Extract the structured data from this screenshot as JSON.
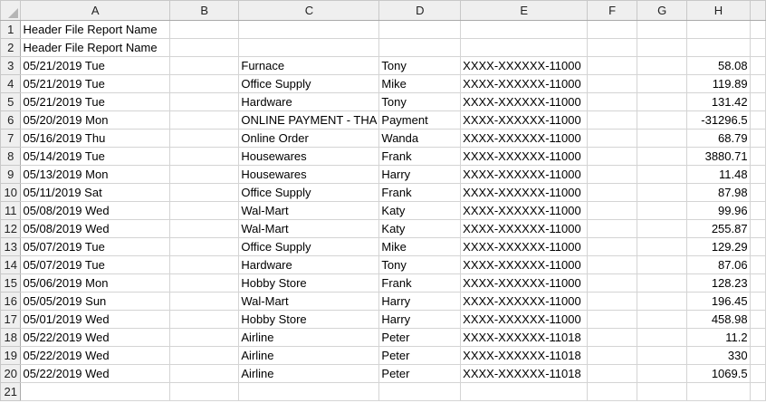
{
  "columns": [
    "A",
    "B",
    "C",
    "D",
    "E",
    "F",
    "G",
    "H",
    ""
  ],
  "header_rows": [
    {
      "num": "1",
      "text": "Header File Report Name"
    },
    {
      "num": "2",
      "text": "Header File Report Name"
    }
  ],
  "rows": [
    {
      "num": "3",
      "a": "05/21/2019  Tue",
      "c": "Furnace",
      "d": "Tony",
      "e": "XXXX-XXXXXX-11000",
      "h": "58.08"
    },
    {
      "num": "4",
      "a": "05/21/2019  Tue",
      "c": "Office Supply",
      "d": "Mike",
      "e": "XXXX-XXXXXX-11000",
      "h": "119.89"
    },
    {
      "num": "5",
      "a": "05/21/2019  Tue",
      "c": "Hardware",
      "d": "Tony",
      "e": "XXXX-XXXXXX-11000",
      "h": "131.42"
    },
    {
      "num": "6",
      "a": "05/20/2019  Mon",
      "c": "ONLINE PAYMENT - THA",
      "d": "Payment",
      "e": "XXXX-XXXXXX-11000",
      "h": "-31296.5"
    },
    {
      "num": "7",
      "a": "05/16/2019  Thu",
      "c": "Online Order",
      "d": "Wanda",
      "e": "XXXX-XXXXXX-11000",
      "h": "68.79"
    },
    {
      "num": "8",
      "a": "05/14/2019  Tue",
      "c": "Housewares",
      "d": "Frank",
      "e": "XXXX-XXXXXX-11000",
      "h": "3880.71"
    },
    {
      "num": "9",
      "a": "05/13/2019  Mon",
      "c": "Housewares",
      "d": "Harry",
      "e": "XXXX-XXXXXX-11000",
      "h": "11.48"
    },
    {
      "num": "10",
      "a": "05/11/2019  Sat",
      "c": "Office Supply",
      "d": "Frank",
      "e": "XXXX-XXXXXX-11000",
      "h": "87.98"
    },
    {
      "num": "11",
      "a": "05/08/2019  Wed",
      "c": "Wal-Mart",
      "d": "Katy",
      "e": "XXXX-XXXXXX-11000",
      "h": "99.96"
    },
    {
      "num": "12",
      "a": "05/08/2019  Wed",
      "c": "Wal-Mart",
      "d": "Katy",
      "e": "XXXX-XXXXXX-11000",
      "h": "255.87"
    },
    {
      "num": "13",
      "a": "05/07/2019  Tue",
      "c": "Office Supply",
      "d": "Mike",
      "e": "XXXX-XXXXXX-11000",
      "h": "129.29"
    },
    {
      "num": "14",
      "a": "05/07/2019  Tue",
      "c": "Hardware",
      "d": "Tony",
      "e": "XXXX-XXXXXX-11000",
      "h": "87.06"
    },
    {
      "num": "15",
      "a": "05/06/2019  Mon",
      "c": "Hobby Store",
      "d": "Frank",
      "e": "XXXX-XXXXXX-11000",
      "h": "128.23"
    },
    {
      "num": "16",
      "a": "05/05/2019  Sun",
      "c": "Wal-Mart",
      "d": "Harry",
      "e": "XXXX-XXXXXX-11000",
      "h": "196.45"
    },
    {
      "num": "17",
      "a": "05/01/2019  Wed",
      "c": "Hobby Store",
      "d": "Harry",
      "e": "XXXX-XXXXXX-11000",
      "h": "458.98"
    },
    {
      "num": "18",
      "a": "05/22/2019  Wed",
      "c": "Airline",
      "d": "Peter",
      "e": "XXXX-XXXXXX-11018",
      "h": "11.2"
    },
    {
      "num": "19",
      "a": "05/22/2019  Wed",
      "c": "Airline",
      "d": "Peter",
      "e": "XXXX-XXXXXX-11018",
      "h": "330"
    },
    {
      "num": "20",
      "a": "05/22/2019  Wed",
      "c": "Airline",
      "d": "Peter",
      "e": "XXXX-XXXXXX-11018",
      "h": "1069.5"
    }
  ],
  "empty_rows": [
    "21"
  ]
}
